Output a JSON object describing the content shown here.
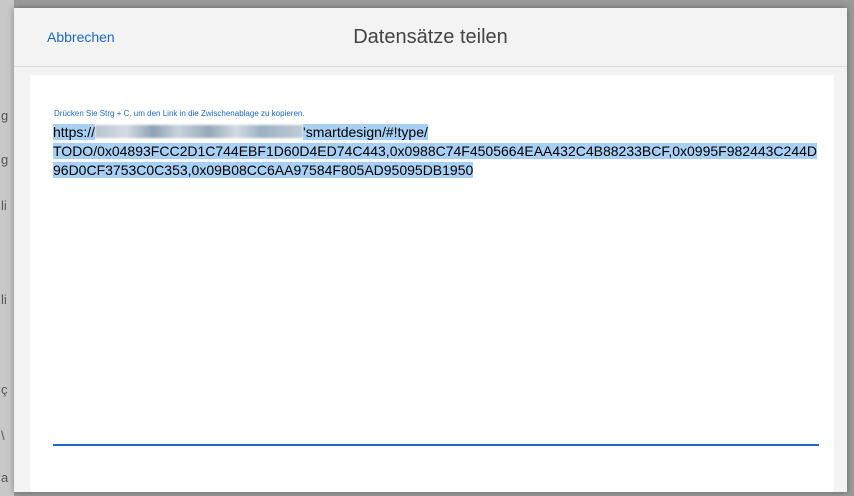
{
  "dialog": {
    "cancel_label": "Abbrechen",
    "title": "Datensätze teilen"
  },
  "content": {
    "hint": "Drücken Sie Strg + C, um den Link in die Zwischenablage zu kopieren.",
    "link_prefix": "https://",
    "link_path_line1": "'smartdesign/#!type/",
    "link_rest": "TODO/0x04893FCC2D1C744EBF1D60D4ED74C443,0x0988C74F4505664EAA432C4B88233BCF,0x0995F982443C244D96D0CF3753C0C353,0x09B08CC6AA97584F805AD95095DB1950"
  },
  "background": {
    "chars": [
      "g",
      "g",
      "li",
      "li",
      "ç",
      "\\",
      "a"
    ]
  },
  "colors": {
    "accent": "#1b6ac9",
    "selection": "#a8d0f5"
  }
}
